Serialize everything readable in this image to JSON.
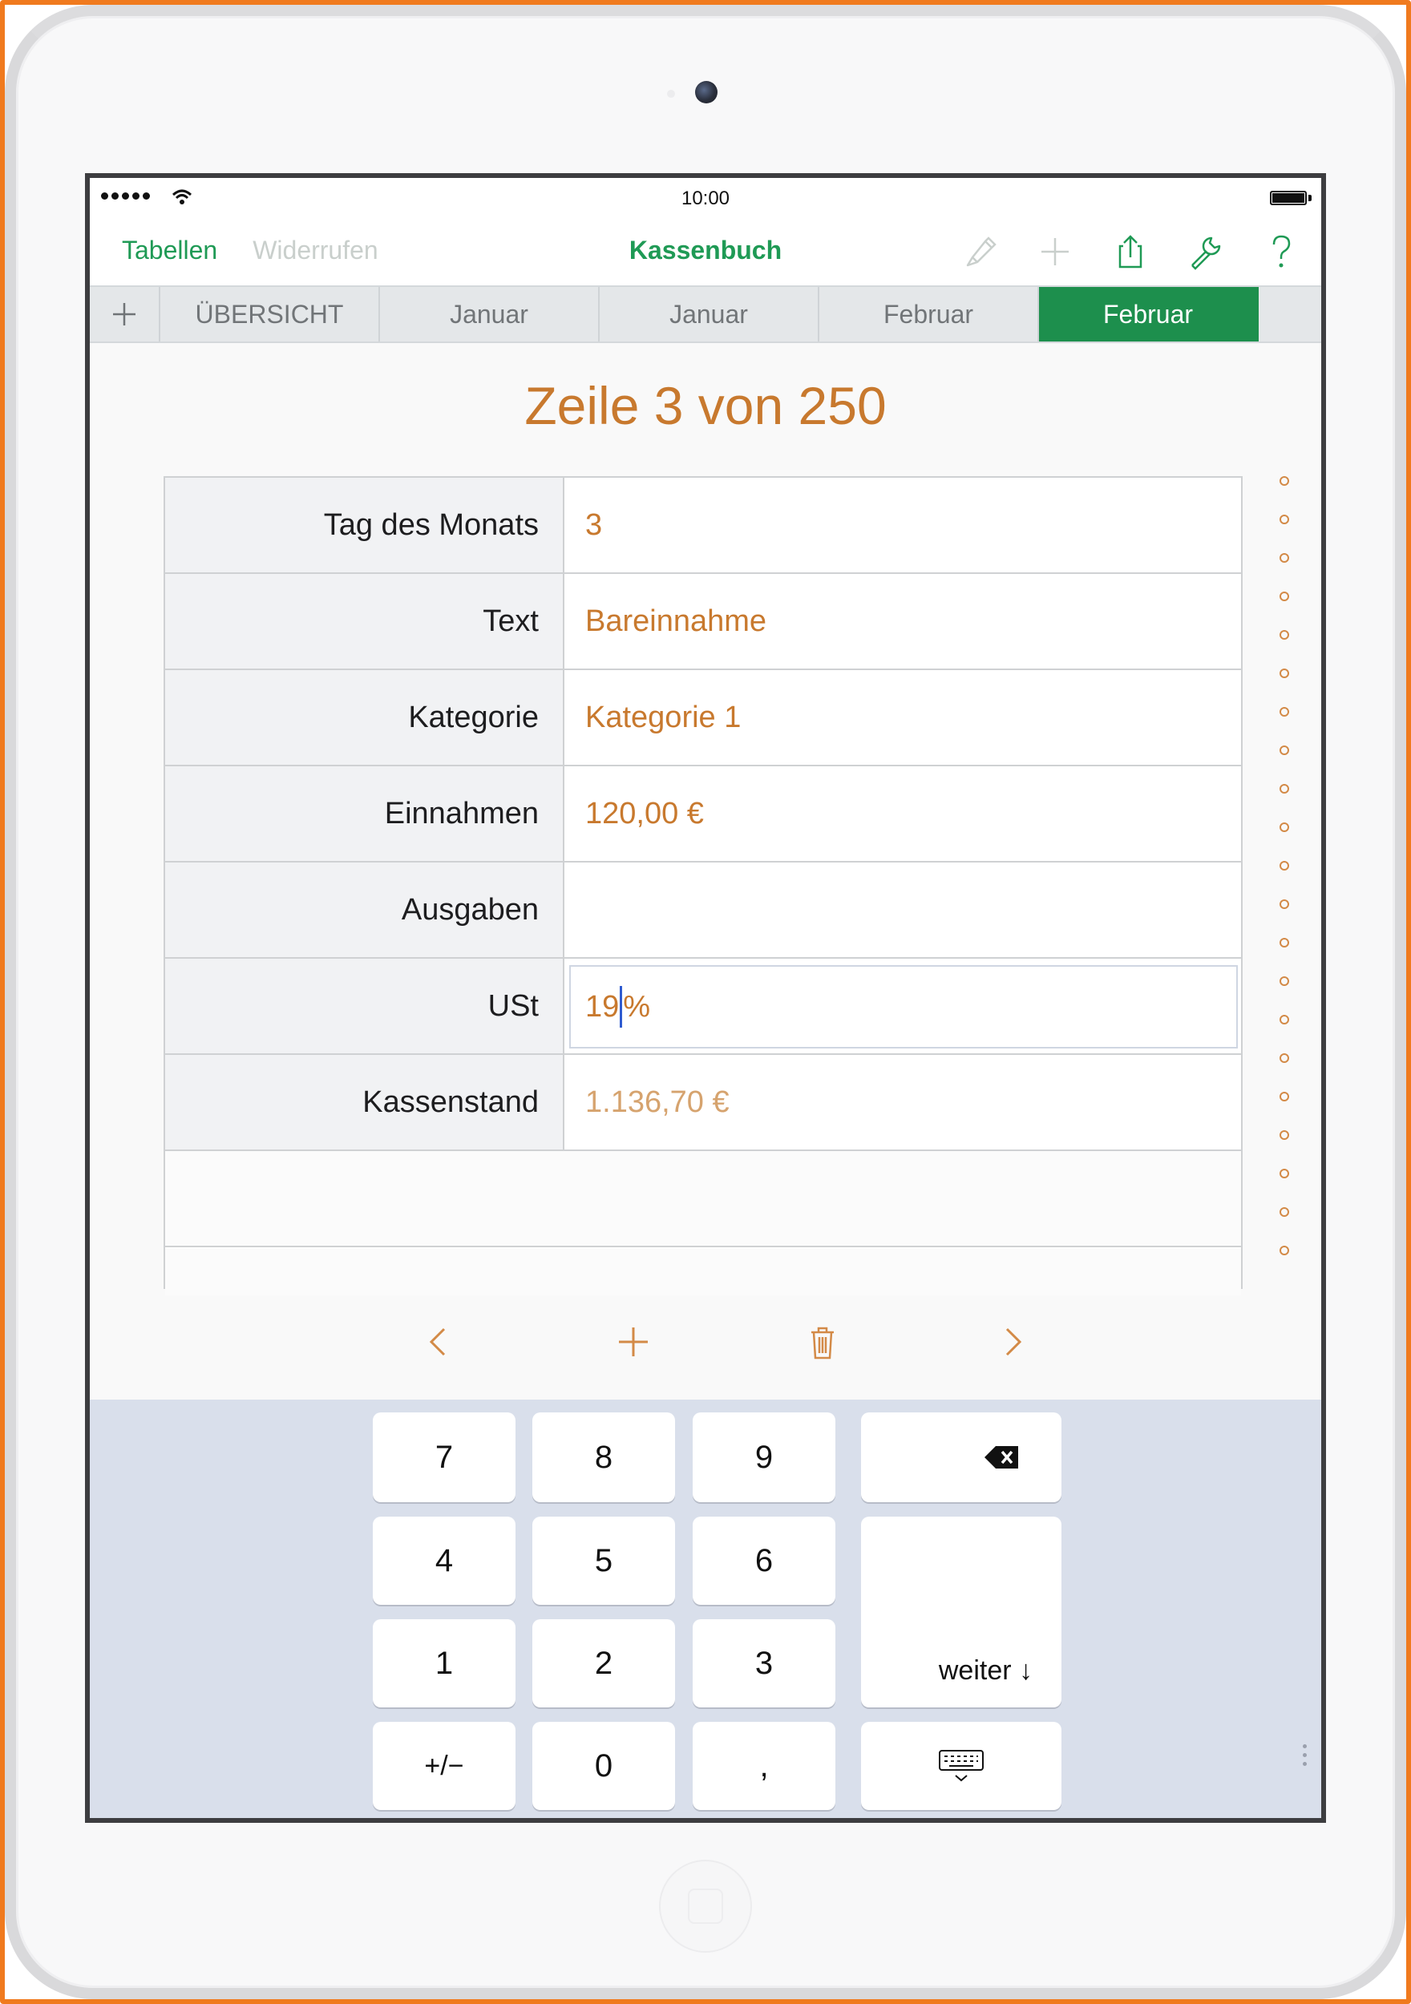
{
  "status_bar": {
    "time": "10:00"
  },
  "toolbar": {
    "left_button": "Tabellen",
    "undo_button": "Widerrufen",
    "title": "Kassenbuch",
    "icons": [
      "brush-icon",
      "plus-icon",
      "share-icon",
      "wrench-icon",
      "help-icon"
    ]
  },
  "tabs": {
    "items": [
      {
        "label": "ÜBERSICHT",
        "active": false
      },
      {
        "label": "Januar",
        "active": false
      },
      {
        "label": "Januar",
        "active": false
      },
      {
        "label": "Februar",
        "active": false
      },
      {
        "label": "Februar",
        "active": true
      }
    ]
  },
  "form": {
    "title": "Zeile 3 von 250",
    "rows": [
      {
        "label": "Tag des Monats",
        "value": "3"
      },
      {
        "label": "Text",
        "value": "Bareinnahme"
      },
      {
        "label": "Kategorie",
        "value": "Kategorie 1"
      },
      {
        "label": "Einnahmen",
        "value": "120,00 €"
      },
      {
        "label": "Ausgaben",
        "value": ""
      },
      {
        "label": "USt",
        "value_before_cursor": "19",
        "value_after_cursor": "%"
      },
      {
        "label": "Kassenstand",
        "value": "1.136,70 €"
      }
    ]
  },
  "keyboard": {
    "keys": {
      "k7": "7",
      "k8": "8",
      "k9": "9",
      "k4": "4",
      "k5": "5",
      "k6": "6",
      "k1": "1",
      "k2": "2",
      "k3": "3",
      "plusminus": "+/−",
      "k0": "0",
      "comma": ",",
      "next": "weiter ↓"
    }
  },
  "colors": {
    "accent_green": "#1f9a55",
    "value_orange": "#c8792e",
    "frame_orange": "#f07a1e"
  }
}
